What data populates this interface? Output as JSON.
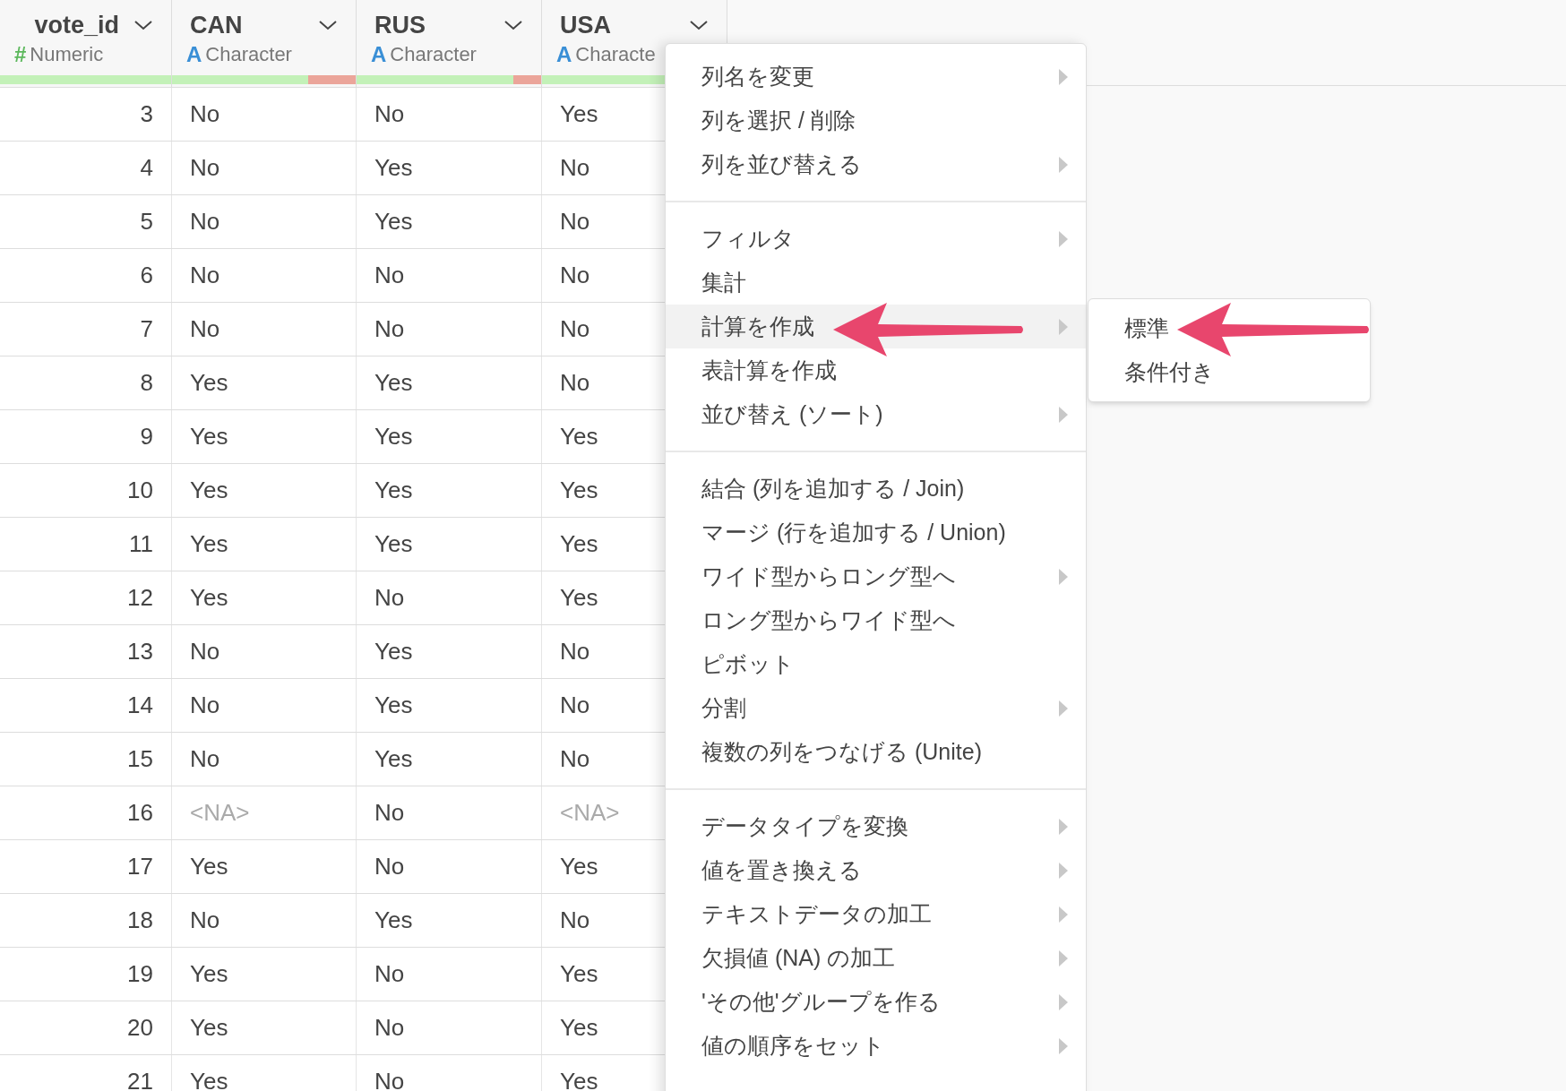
{
  "table": {
    "columns": [
      {
        "name": "vote_id",
        "type_icon": "#",
        "type": "Numeric",
        "kind": "numeric",
        "quality": {
          "level": 1
        }
      },
      {
        "name": "CAN",
        "type_icon": "A",
        "type": "Character",
        "kind": "character",
        "quality": {
          "level": 0.74
        }
      },
      {
        "name": "RUS",
        "type_icon": "A",
        "type": "Character",
        "kind": "character",
        "quality": {
          "level": 0.85
        }
      },
      {
        "name": "USA",
        "type_icon": "A",
        "type": "Characte",
        "kind": "character",
        "quality": {
          "level": 1
        }
      }
    ],
    "rows": [
      [
        {
          "v": "3",
          "na": false
        },
        {
          "v": "No",
          "na": false
        },
        {
          "v": "No",
          "na": false
        },
        {
          "v": "Yes",
          "na": false
        }
      ],
      [
        {
          "v": "4",
          "na": false
        },
        {
          "v": "No",
          "na": false
        },
        {
          "v": "Yes",
          "na": false
        },
        {
          "v": "No",
          "na": false
        }
      ],
      [
        {
          "v": "5",
          "na": false
        },
        {
          "v": "No",
          "na": false
        },
        {
          "v": "Yes",
          "na": false
        },
        {
          "v": "No",
          "na": false
        }
      ],
      [
        {
          "v": "6",
          "na": false
        },
        {
          "v": "No",
          "na": false
        },
        {
          "v": "No",
          "na": false
        },
        {
          "v": "No",
          "na": false
        }
      ],
      [
        {
          "v": "7",
          "na": false
        },
        {
          "v": "No",
          "na": false
        },
        {
          "v": "No",
          "na": false
        },
        {
          "v": "No",
          "na": false
        }
      ],
      [
        {
          "v": "8",
          "na": false
        },
        {
          "v": "Yes",
          "na": false
        },
        {
          "v": "Yes",
          "na": false
        },
        {
          "v": "No",
          "na": false
        }
      ],
      [
        {
          "v": "9",
          "na": false
        },
        {
          "v": "Yes",
          "na": false
        },
        {
          "v": "Yes",
          "na": false
        },
        {
          "v": "Yes",
          "na": false
        }
      ],
      [
        {
          "v": "10",
          "na": false
        },
        {
          "v": "Yes",
          "na": false
        },
        {
          "v": "Yes",
          "na": false
        },
        {
          "v": "Yes",
          "na": false
        }
      ],
      [
        {
          "v": "11",
          "na": false
        },
        {
          "v": "Yes",
          "na": false
        },
        {
          "v": "Yes",
          "na": false
        },
        {
          "v": "Yes",
          "na": false
        }
      ],
      [
        {
          "v": "12",
          "na": false
        },
        {
          "v": "Yes",
          "na": false
        },
        {
          "v": "No",
          "na": false
        },
        {
          "v": "Yes",
          "na": false
        }
      ],
      [
        {
          "v": "13",
          "na": false
        },
        {
          "v": "No",
          "na": false
        },
        {
          "v": "Yes",
          "na": false
        },
        {
          "v": "No",
          "na": false
        }
      ],
      [
        {
          "v": "14",
          "na": false
        },
        {
          "v": "No",
          "na": false
        },
        {
          "v": "Yes",
          "na": false
        },
        {
          "v": "No",
          "na": false
        }
      ],
      [
        {
          "v": "15",
          "na": false
        },
        {
          "v": "No",
          "na": false
        },
        {
          "v": "Yes",
          "na": false
        },
        {
          "v": "No",
          "na": false
        }
      ],
      [
        {
          "v": "16",
          "na": false
        },
        {
          "v": "<NA>",
          "na": true
        },
        {
          "v": "No",
          "na": false
        },
        {
          "v": "<NA>",
          "na": true
        }
      ],
      [
        {
          "v": "17",
          "na": false
        },
        {
          "v": "Yes",
          "na": false
        },
        {
          "v": "No",
          "na": false
        },
        {
          "v": "Yes",
          "na": false
        }
      ],
      [
        {
          "v": "18",
          "na": false
        },
        {
          "v": "No",
          "na": false
        },
        {
          "v": "Yes",
          "na": false
        },
        {
          "v": "No",
          "na": false
        }
      ],
      [
        {
          "v": "19",
          "na": false
        },
        {
          "v": "Yes",
          "na": false
        },
        {
          "v": "No",
          "na": false
        },
        {
          "v": "Yes",
          "na": false
        }
      ],
      [
        {
          "v": "20",
          "na": false
        },
        {
          "v": "Yes",
          "na": false
        },
        {
          "v": "No",
          "na": false
        },
        {
          "v": "Yes",
          "na": false
        }
      ],
      [
        {
          "v": "21",
          "na": false
        },
        {
          "v": "Yes",
          "na": false
        },
        {
          "v": "No",
          "na": false
        },
        {
          "v": "Yes",
          "na": false
        }
      ]
    ]
  },
  "context_menu": {
    "groups": [
      [
        {
          "label": "列名を変更",
          "submenu": true,
          "selected": false
        },
        {
          "label": "列を選択 / 削除",
          "submenu": false,
          "selected": false
        },
        {
          "label": "列を並び替える",
          "submenu": true,
          "selected": false
        }
      ],
      [
        {
          "label": "フィルタ",
          "submenu": true,
          "selected": false
        },
        {
          "label": "集計",
          "submenu": false,
          "selected": false
        },
        {
          "label": "計算を作成",
          "submenu": true,
          "selected": true
        },
        {
          "label": "表計算を作成",
          "submenu": false,
          "selected": false
        },
        {
          "label": "並び替え (ソート)",
          "submenu": true,
          "selected": false
        }
      ],
      [
        {
          "label": "結合 (列を追加する / Join)",
          "submenu": false,
          "selected": false
        },
        {
          "label": "マージ (行を追加する / Union)",
          "submenu": false,
          "selected": false
        },
        {
          "label": "ワイド型からロング型へ",
          "submenu": true,
          "selected": false
        },
        {
          "label": "ロング型からワイド型へ",
          "submenu": false,
          "selected": false
        },
        {
          "label": "ピボット",
          "submenu": false,
          "selected": false
        },
        {
          "label": "分割",
          "submenu": true,
          "selected": false
        },
        {
          "label": "複数の列をつなげる (Unite)",
          "submenu": false,
          "selected": false
        }
      ],
      [
        {
          "label": "データタイプを変換",
          "submenu": true,
          "selected": false
        },
        {
          "label": "値を置き換える",
          "submenu": true,
          "selected": false
        },
        {
          "label": "テキストデータの加工",
          "submenu": true,
          "selected": false
        },
        {
          "label": "欠損値 (NA) の加工",
          "submenu": true,
          "selected": false
        },
        {
          "label": "'その他'グループを作る",
          "submenu": true,
          "selected": false
        },
        {
          "label": "値の順序をセット",
          "submenu": true,
          "selected": false
        }
      ]
    ]
  },
  "submenu": {
    "items": [
      {
        "label": "標準"
      },
      {
        "label": "条件付き"
      }
    ]
  }
}
